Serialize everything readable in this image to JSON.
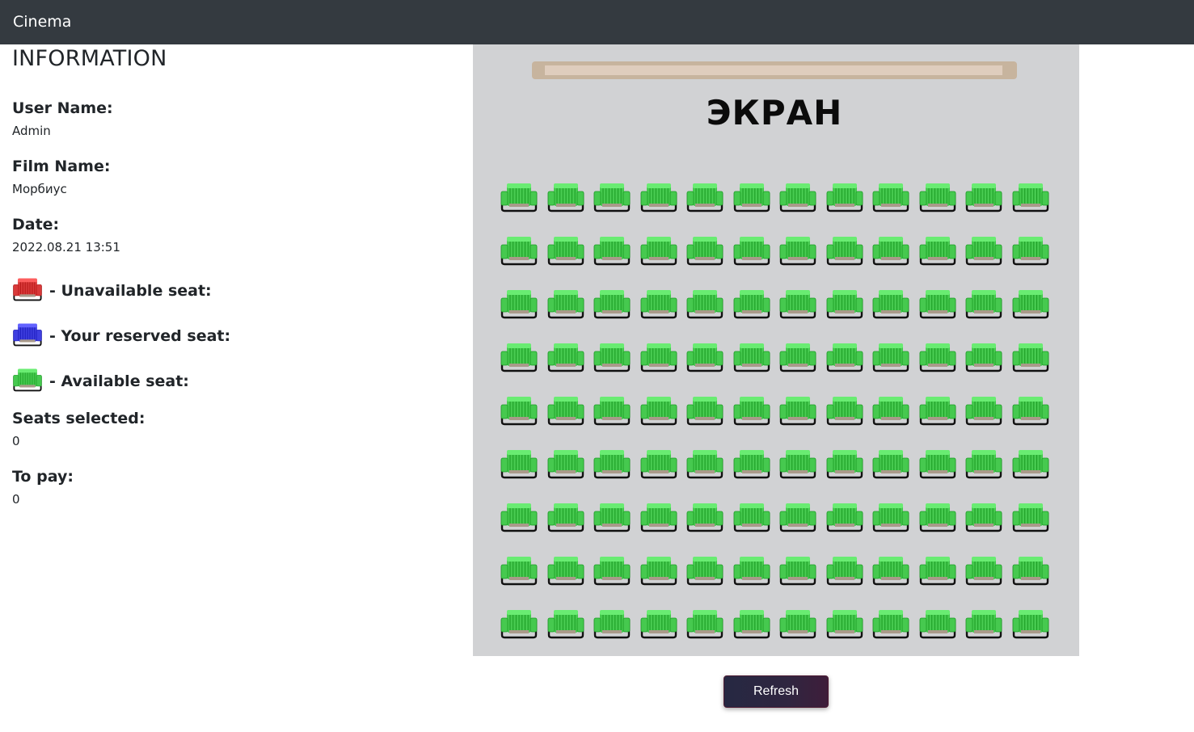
{
  "navbar": {
    "brand": "Cinema"
  },
  "info": {
    "title": "INFORMATION",
    "user_name_label": "User Name:",
    "user_name_value": "Admin",
    "film_name_label": "Film Name:",
    "film_name_value": "Морбиус",
    "date_label": "Date:",
    "date_value": "2022.08.21 13:51",
    "seats_selected_label": "Seats selected:",
    "seats_selected_value": "0",
    "to_pay_label": "To pay:",
    "to_pay_value": "0"
  },
  "legend": [
    {
      "label": "- Unavailable seat:",
      "status": "unavailable",
      "color": "#d93a3a"
    },
    {
      "label": "- Your reserved seat:",
      "status": "reserved",
      "color": "#3f3fe0"
    },
    {
      "label": "- Available seat:",
      "status": "available",
      "color": "#46c94f"
    }
  ],
  "hall": {
    "screen_label": "ЭКРАН",
    "rows": 9,
    "seats_per_row": 12,
    "seat_status": "available",
    "colors": {
      "available": "#46c94f",
      "unavailable": "#d93a3a",
      "reserved": "#3f3fe0"
    }
  },
  "actions": {
    "refresh_label": "Refresh"
  }
}
